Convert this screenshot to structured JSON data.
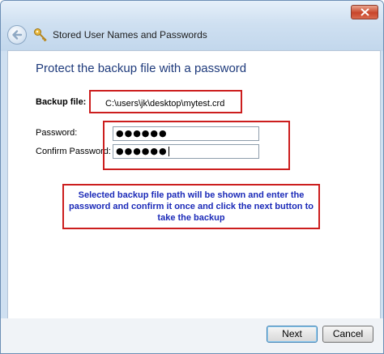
{
  "window": {
    "title": "Stored User Names and Passwords"
  },
  "page": {
    "heading": "Protect the backup file with a password",
    "backup_file_label": "Backup file:",
    "backup_file_path": "C:\\users\\jk\\desktop\\mytest.crd",
    "password_label": "Password:",
    "confirm_password_label": "Confirm Password:",
    "password_value": "●●●●●●",
    "confirm_password_value": "●●●●●●",
    "callout_text": "Selected backup file path will be shown and enter the password and confirm it once and click the next button to take the backup"
  },
  "buttons": {
    "next": "Next",
    "cancel": "Cancel"
  },
  "icons": {
    "back": "back-arrow-icon",
    "close": "close-icon",
    "app": "key-icon"
  },
  "colors": {
    "annotation_border": "#cc1e1e",
    "callout_text": "#1b2ab8",
    "heading_text": "#1e3a7b",
    "close_button": "#c8452a"
  }
}
